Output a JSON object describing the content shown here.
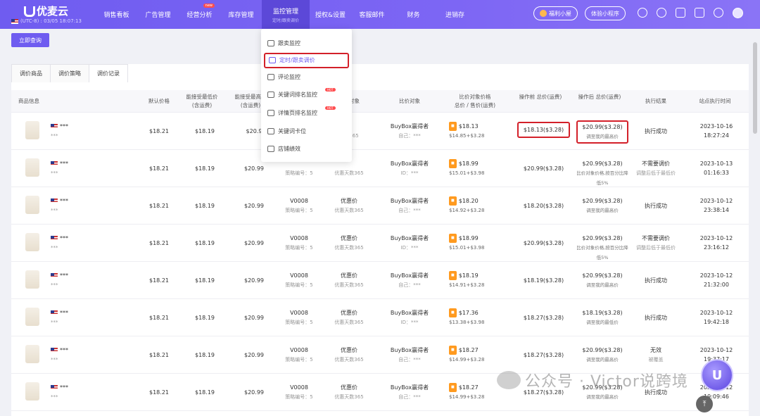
{
  "app": {
    "name": "优麦云",
    "timezone": "(UTC-8) : 03/05 18:07:13"
  },
  "nav": {
    "items": [
      "销售看板",
      "广告管理",
      "经营分析",
      "库存管理",
      "监控管理",
      "授权&设置",
      "客服邮件",
      "财务",
      "进销存"
    ],
    "active_sub": "定时/跟卖调价",
    "badge": "new"
  },
  "header_right": {
    "welfare": "福利小屋",
    "miniapp": "体验小程序"
  },
  "query_button": "立即查询",
  "tabs": [
    "调价商品",
    "调价策略",
    "调价记录"
  ],
  "columns": [
    "商品信息",
    "默认价格",
    "能接受最低价\n(含运费)",
    "能接受最高价\n(含运费)",
    "策略",
    "调价对象",
    "比价对象",
    "比价对象价格\n总价 / 售价(运费)",
    "操作前 总价(运费)",
    "操作后 总价(运费)",
    "执行结果",
    "站点执行时间"
  ],
  "dropdown": {
    "items": [
      "跟卖监控",
      "定时/跟卖调价",
      "评论监控",
      "关键词排名监控",
      "详情页排名监控",
      "关键词卡位",
      "店铺绩效"
    ],
    "hot_label": "HOT"
  },
  "rows": [
    {
      "sku": "***",
      "sub": "***",
      "default": "$18.21",
      "min": "$18.19",
      "max": "$20.9",
      "strategy": "",
      "strategy_no": "",
      "target": "价",
      "target_sub": "天数365",
      "cmp": "BuyBox赢得者",
      "cmp_sub": "自己：***",
      "cmp_price": "$18.13",
      "cmp_detail": "$14.85+$3.28",
      "before": "$18.13($3.28)",
      "after": "$20.99($3.28)",
      "after_sub": "调至我的最高价",
      "result": "执行成功",
      "result_sub": "",
      "date": "2023-10-16",
      "time": "18:27:24"
    },
    {
      "sku": "***",
      "sub": "***",
      "default": "$18.21",
      "min": "$18.19",
      "max": "$20.99",
      "strategy": "",
      "strategy_no": "策略编号：5",
      "target": "",
      "target_sub": "优惠天数365",
      "cmp": "BuyBox赢得者",
      "cmp_sub": "ID：***",
      "cmp_price": "$18.99",
      "cmp_detail": "$15.01+$3.98",
      "before": "$20.99($3.28)",
      "after": "$20.99($3.28)",
      "after_sub": "比价对象价格,按百分比降低5%",
      "result": "不需要调价",
      "result_sub": "调整后低于最低价",
      "date": "2023-10-13",
      "time": "01:16:33"
    },
    {
      "sku": "***",
      "sub": "***",
      "default": "$18.21",
      "min": "$18.19",
      "max": "$20.99",
      "strategy": "V0008",
      "strategy_no": "策略编号：5",
      "target": "优惠价",
      "target_sub": "优惠天数365",
      "cmp": "BuyBox赢得者",
      "cmp_sub": "自己：***",
      "cmp_price": "$18.20",
      "cmp_detail": "$14.92+$3.28",
      "before": "$18.20($3.28)",
      "after": "$20.99($3.28)",
      "after_sub": "调至我的最高价",
      "result": "执行成功",
      "result_sub": "",
      "date": "2023-10-12",
      "time": "23:38:14"
    },
    {
      "sku": "***",
      "sub": "***",
      "default": "$18.21",
      "min": "$18.19",
      "max": "$20.99",
      "strategy": "V0008",
      "strategy_no": "策略编号：5",
      "target": "优惠价",
      "target_sub": "优惠天数365",
      "cmp": "BuyBox赢得者",
      "cmp_sub": "ID：***",
      "cmp_price": "$18.99",
      "cmp_detail": "$15.01+$3.98",
      "before": "$20.99($3.28)",
      "after": "$20.99($3.28)",
      "after_sub": "比价对象价格,按百分比降低5%",
      "result": "不需要调价",
      "result_sub": "调整后低于最低价",
      "date": "2023-10-12",
      "time": "23:16:12"
    },
    {
      "sku": "***",
      "sub": "***",
      "default": "$18.21",
      "min": "$18.19",
      "max": "$20.99",
      "strategy": "V0008",
      "strategy_no": "策略编号：5",
      "target": "优惠价",
      "target_sub": "优惠天数365",
      "cmp": "BuyBox赢得者",
      "cmp_sub": "自己：***",
      "cmp_price": "$18.19",
      "cmp_detail": "$14.91+$3.28",
      "before": "$18.19($3.28)",
      "after": "$20.99($3.28)",
      "after_sub": "调至我的最高价",
      "result": "执行成功",
      "result_sub": "",
      "date": "2023-10-12",
      "time": "21:32:00"
    },
    {
      "sku": "***",
      "sub": "***",
      "default": "$18.21",
      "min": "$18.19",
      "max": "$20.99",
      "strategy": "V0008",
      "strategy_no": "策略编号：5",
      "target": "优惠价",
      "target_sub": "优惠天数365",
      "cmp": "BuyBox赢得者",
      "cmp_sub": "ID：***",
      "cmp_price": "$17.36",
      "cmp_detail": "$13.38+$3.98",
      "before": "$18.27($3.28)",
      "after": "$18.19($3.28)",
      "after_sub": "调至我的最低价",
      "result": "执行成功",
      "result_sub": "",
      "date": "2023-10-12",
      "time": "19:42:18"
    },
    {
      "sku": "***",
      "sub": "***",
      "default": "$18.21",
      "min": "$18.19",
      "max": "$20.99",
      "strategy": "V0008",
      "strategy_no": "策略编号：5",
      "target": "优惠价",
      "target_sub": "优惠天数365",
      "cmp": "BuyBox赢得者",
      "cmp_sub": "自己：***",
      "cmp_price": "$18.27",
      "cmp_detail": "$14.99+$3.28",
      "before": "$18.27($3.28)",
      "after": "$20.99($3.28)",
      "after_sub": "调至我的最高价",
      "result": "无效",
      "result_sub": "被覆盖",
      "date": "2023-10-12",
      "time": "19:37:17"
    },
    {
      "sku": "***",
      "sub": "***",
      "default": "$18.21",
      "min": "$18.19",
      "max": "$20.99",
      "strategy": "V0008",
      "strategy_no": "策略编号：5",
      "target": "优惠价",
      "target_sub": "优惠天数365",
      "cmp": "BuyBox赢得者",
      "cmp_sub": "自己：***",
      "cmp_price": "$18.27",
      "cmp_detail": "$14.99+$3.28",
      "before": "$18.27($3.28)",
      "after": "$20.99($3.28)",
      "after_sub": "调至我的最高价",
      "result": "执行成功",
      "result_sub": "",
      "date": "2023-10-12",
      "time": "19:09:46"
    }
  ],
  "watermark": "公众号 · Victor说跨境",
  "float_ball": "U",
  "top_button": "⤒"
}
